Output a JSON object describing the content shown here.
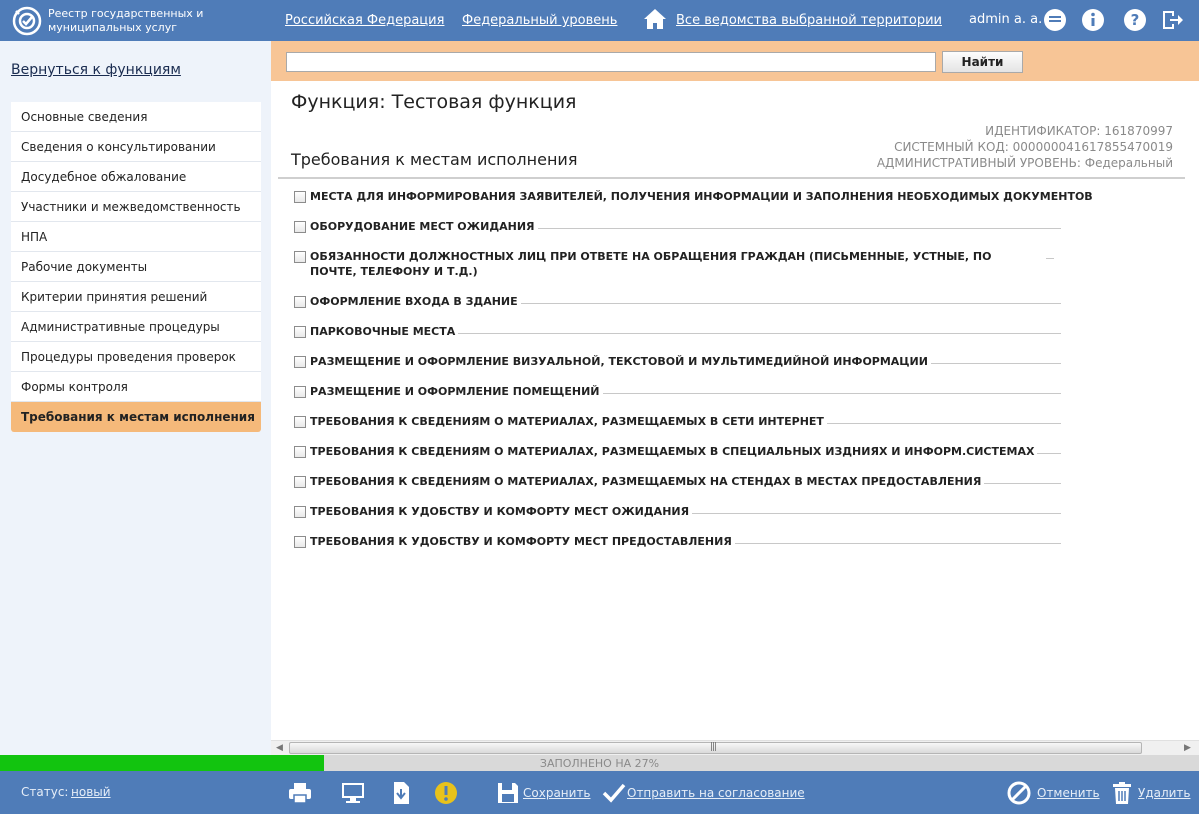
{
  "header": {
    "logo_text": "Реестр государственных и муниципальных услуг",
    "region": "Российская Федерация",
    "level": "Федеральный уровень",
    "agencies": "Все ведомства выбранной территории",
    "user": "admin a. a."
  },
  "sidebar": {
    "back_link": "Вернуться к функциям",
    "items": [
      {
        "label": "Основные сведения"
      },
      {
        "label": "Сведения о консультировании"
      },
      {
        "label": "Досудебное обжалование"
      },
      {
        "label": "Участники и межведомственность"
      },
      {
        "label": "НПА"
      },
      {
        "label": "Рабочие документы"
      },
      {
        "label": "Критерии принятия решений"
      },
      {
        "label": "Административные процедуры"
      },
      {
        "label": "Процедуры проведения проверок"
      },
      {
        "label": "Формы контроля"
      },
      {
        "label": "Требования к местам исполнения",
        "active": true
      }
    ]
  },
  "search": {
    "value": "",
    "button_label": "Найти"
  },
  "main": {
    "function_title": "Функция: Тестовая функция",
    "identifier": "ИДЕНТИФИКАТОР: 161870997",
    "system_code": "СИСТЕМНЫЙ КОД: 000000041617855470019",
    "admin_level": "АДМИНИСТРАТИВНЫЙ УРОВЕНЬ: Федеральный",
    "section_title": "Требования к местам исполнения",
    "requirements": [
      "МЕСТА ДЛЯ ИНФОРМИРОВАНИЯ ЗАЯВИТЕЛЕЙ, ПОЛУЧЕНИЯ ИНФОРМАЦИИ И ЗАПОЛНЕНИЯ НЕОБХОДИМЫХ ДОКУМЕНТОВ",
      "ОБОРУДОВАНИЕ МЕСТ ОЖИДАНИЯ",
      "ОБЯЗАННОСТИ ДОЛЖНОСТНЫХ ЛИЦ ПРИ ОТВЕТЕ НА ОБРАЩЕНИЯ ГРАЖДАН (ПИСЬМЕННЫЕ, УСТНЫЕ, ПО ПОЧТЕ, ТЕЛЕФОНУ И Т.Д.)",
      "ОФОРМЛЕНИЕ ВХОДА В ЗДАНИЕ",
      "ПАРКОВОЧНЫЕ МЕСТА",
      "РАЗМЕЩЕНИЕ И ОФОРМЛЕНИЕ ВИЗУАЛЬНОЙ, ТЕКСТОВОЙ И МУЛЬТИМЕДИЙНОЙ ИНФОРМАЦИИ",
      "РАЗМЕЩЕНИЕ И ОФОРМЛЕНИЕ ПОМЕЩЕНИЙ",
      "ТРЕБОВАНИЯ К СВЕДЕНИЯМ О МАТЕРИАЛАХ, РАЗМЕЩАЕМЫХ В СЕТИ ИНТЕРНЕТ",
      "ТРЕБОВАНИЯ К СВЕДЕНИЯМ О МАТЕРИАЛАХ, РАЗМЕЩАЕМЫХ В СПЕЦИАЛЬНЫХ ИЗДНИЯХ И ИНФОРМ.СИСТЕМАХ",
      "ТРЕБОВАНИЯ К СВЕДЕНИЯМ О МАТЕРИАЛАХ, РАЗМЕЩАЕМЫХ НА СТЕНДАХ В МЕСТАХ ПРЕДОСТАВЛЕНИЯ",
      "ТРЕБОВАНИЯ К УДОБСТВУ И КОМФОРТУ МЕСТ ОЖИДАНИЯ",
      "ТРЕБОВАНИЯ К УДОБСТВУ И КОМФОРТУ МЕСТ ПРЕДОСТАВЛЕНИЯ"
    ]
  },
  "progress": {
    "label": "ЗАПОЛНЕНО НА 27%",
    "percent": 27
  },
  "footer": {
    "status_label": "Статус:",
    "status_value": "новый",
    "save": "Сохранить",
    "send": "Отправить на согласование",
    "cancel": "Отменить",
    "delete": "Удалить"
  },
  "colors": {
    "header_bg": "#4f7cb8",
    "accent_orange": "#f5b97a",
    "progress_green": "#12c40f"
  }
}
